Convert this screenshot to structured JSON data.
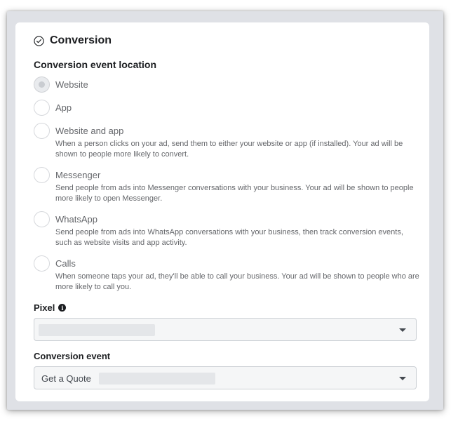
{
  "section": {
    "title": "Conversion",
    "icon": "check-circle-icon"
  },
  "location": {
    "heading": "Conversion event location",
    "options": [
      {
        "label": "Website",
        "description": "",
        "state": "selected-disabled"
      },
      {
        "label": "App",
        "description": "",
        "state": "unselected"
      },
      {
        "label": "Website and app",
        "description": "When a person clicks on your ad, send them to either your website or app (if installed). Your ad will be shown to people more likely to convert.",
        "state": "unselected"
      },
      {
        "label": "Messenger",
        "description": "Send people from ads into Messenger conversations with your business. Your ad will be shown to people more likely to open Messenger.",
        "state": "unselected"
      },
      {
        "label": "WhatsApp",
        "description": "Send people from ads into WhatsApp conversations with your business, then track conversion events, such as website visits and app activity.",
        "state": "unselected"
      },
      {
        "label": "Calls",
        "description": "When someone taps your ad, they'll be able to call your business. Your ad will be shown to people who are more likely to call you.",
        "state": "unselected"
      }
    ]
  },
  "pixel": {
    "label": "Pixel",
    "info_icon": "info-icon",
    "value": ""
  },
  "conversion_event": {
    "label": "Conversion event",
    "value": "Get a Quote"
  }
}
